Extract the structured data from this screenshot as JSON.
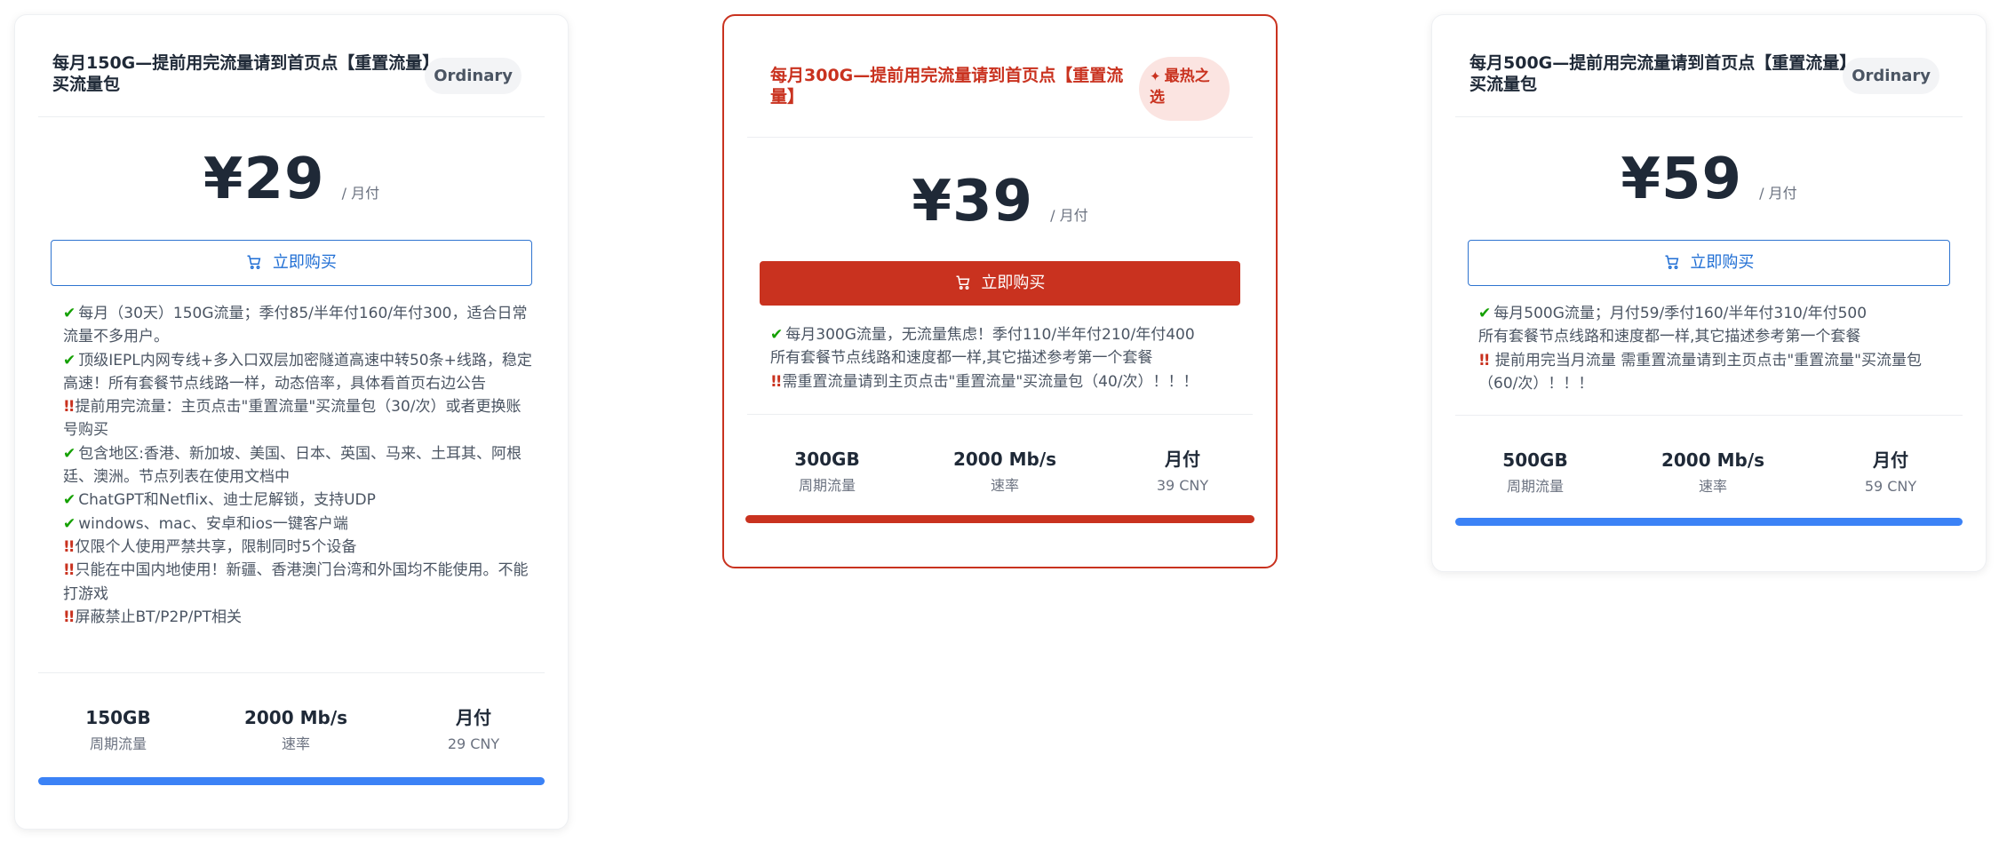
{
  "plans": [
    {
      "title": "每月150G—提前用完流量请到首页点【重置流量】买流量包",
      "badge": "Ordinary",
      "price": "¥29",
      "period": "/ 月付",
      "buy_label": "立即购买",
      "description": [
        {
          "icon": "check",
          "text": "每月（30天）150G流量；季付85/半年付160/年付300，适合日常流量不多用户。"
        },
        {
          "icon": "check",
          "text": "顶级IEPL内网专线+多入口双层加密隧道高速中转50条+线路，稳定高速！所有套餐节点线路一样，动态倍率，具体看首页右边公告"
        },
        {
          "icon": "warning",
          "text": "提前用完流量：主页点击\"重置流量\"买流量包（30/次）或者更换账号购买"
        },
        {
          "icon": "check",
          "text": "包含地区:香港、新加坡、美国、日本、英国、马来、土耳其、阿根廷、澳洲。节点列表在使用文档中"
        },
        {
          "icon": "check",
          "text": "ChatGPT和Netflix、迪士尼解锁，支持UDP"
        },
        {
          "icon": "check",
          "text": "windows、mac、安卓和ios一键客户端"
        },
        {
          "icon": "warning",
          "text": "仅限个人使用严禁共享，限制同时5个设备"
        },
        {
          "icon": "warning",
          "text": "只能在中国内地使用！新疆、香港澳门台湾和外国均不能使用。不能打游戏"
        },
        {
          "icon": "warning",
          "text": "屏蔽禁止BT/P2P/PT相关"
        }
      ],
      "stats": [
        {
          "value": "150GB",
          "label": "周期流量"
        },
        {
          "value": "2000 Mb/s",
          "label": "速率"
        },
        {
          "value": "月付",
          "label": "29 CNY"
        }
      ]
    },
    {
      "title": "每月300G—提前用完流量请到首页点【重置流量】",
      "badge": "最热之选",
      "price": "¥39",
      "period": "/ 月付",
      "buy_label": "立即购买",
      "description": [
        {
          "icon": "check",
          "text": "每月300G流量，无流量焦虑！季付110/半年付210/年付400"
        },
        {
          "icon": "none",
          "text": "所有套餐节点线路和速度都一样,其它描述参考第一个套餐"
        },
        {
          "icon": "warning",
          "text": "需重置流量请到主页点击\"重置流量\"买流量包（40/次）！！！"
        }
      ],
      "stats": [
        {
          "value": "300GB",
          "label": "周期流量"
        },
        {
          "value": "2000 Mb/s",
          "label": "速率"
        },
        {
          "value": "月付",
          "label": "39 CNY"
        }
      ]
    },
    {
      "title": "每月500G—提前用完流量请到首页点【重置流量】买流量包",
      "badge": "Ordinary",
      "price": "¥59",
      "period": "/ 月付",
      "buy_label": "立即购买",
      "description": [
        {
          "icon": "check",
          "text": "每月500G流量；月付59/季付160/半年付310/年付500"
        },
        {
          "icon": "none",
          "text": "所有套餐节点线路和速度都一样,其它描述参考第一个套餐"
        },
        {
          "icon": "warning",
          "text": " 提前用完当月流量 需重置流量请到主页点击\"重置流量\"买流量包（60/次）！！！"
        }
      ],
      "stats": [
        {
          "value": "500GB",
          "label": "周期流量"
        },
        {
          "value": "2000 Mb/s",
          "label": "速率"
        },
        {
          "value": "月付",
          "label": "59 CNY"
        }
      ]
    }
  ],
  "colors": {
    "accent_blue": "#3b82f6",
    "hot_red": "#c9321f",
    "check_green": "#14a000"
  }
}
